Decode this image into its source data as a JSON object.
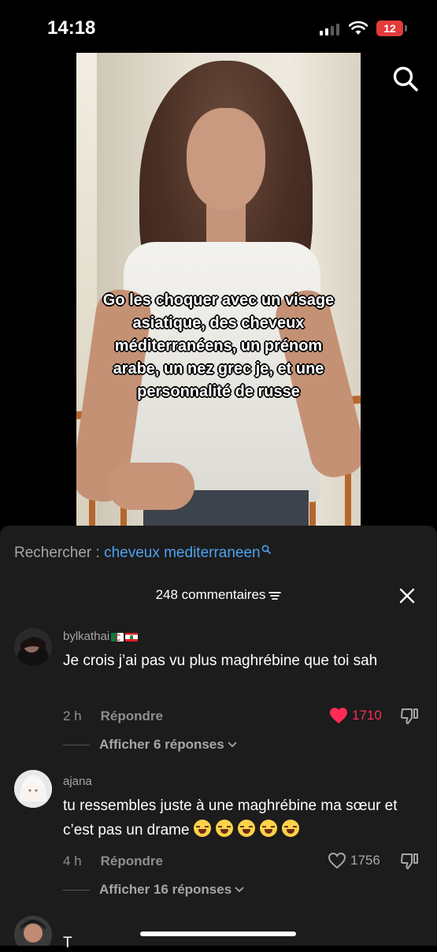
{
  "status_bar": {
    "time": "14:18",
    "battery": "12"
  },
  "video": {
    "caption": "Go les choquer avec un visage asiatique, des cheveux méditerranéens, un prénom arabe, un nez grec je, et une personnalité de russe"
  },
  "comments_panel": {
    "search_prefix": "Rechercher :",
    "search_term": "cheveux mediterraneen",
    "count_label": "248 commentaires",
    "comments": [
      {
        "username": "bylkathai",
        "text": "Je crois j’ai pas vu plus maghrébine que toi sah",
        "time": "2 h",
        "reply_label": "Répondre",
        "likes": "1710",
        "liked": true,
        "replies_label": "Afficher 6 réponses"
      },
      {
        "username": "ajana",
        "text": "tu ressembles juste à une maghrébine ma sœur et c’est pas un drame",
        "emoji_count": 5,
        "time": "4 h",
        "reply_label": "Répondre",
        "likes": "1756",
        "liked": false,
        "replies_label": "Afficher 16 réponses"
      }
    ],
    "peek_text": "T"
  },
  "colors": {
    "accent_link": "#4ea1f3",
    "like_red": "#fe2c55",
    "panel_bg": "#1c1c1c"
  }
}
